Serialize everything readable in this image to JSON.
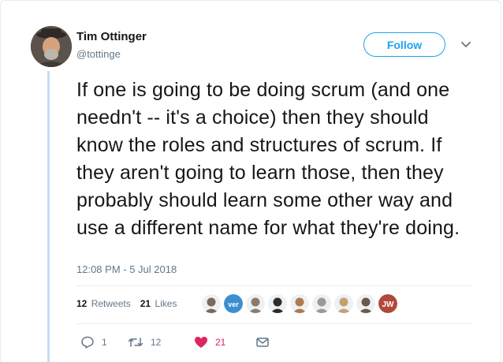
{
  "author": {
    "name": "Tim Ottinger",
    "handle": "@tottinge",
    "avatar_icon": "user-avatar"
  },
  "follow_button": {
    "label": "Follow",
    "color": "#1da1f2"
  },
  "menu_icon": "chevron-down-icon",
  "tweet": {
    "text": "If one is going to be doing scrum (and one needn't -- it's a choice) then they should know the roles and structures of scrum. If they aren't going to learn those, then they probably should learn some other way and use a different name for what they're doing.",
    "timestamp": "12:08 PM - 5 Jul 2018"
  },
  "stats": {
    "retweets_count": "12",
    "retweets_label": "Retweets",
    "likes_count": "21",
    "likes_label": "Likes"
  },
  "likers": [
    {
      "name": "liker-1",
      "color": "#7a6a5e"
    },
    {
      "name": "liker-2",
      "color": "#3b8fd0",
      "text": "ver"
    },
    {
      "name": "liker-3",
      "color": "#8a7c6a"
    },
    {
      "name": "liker-4",
      "color": "#2c2c2c"
    },
    {
      "name": "liker-5",
      "color": "#b07a4c"
    },
    {
      "name": "liker-6",
      "color": "#9a9a9a"
    },
    {
      "name": "liker-7",
      "color": "#c8a070"
    },
    {
      "name": "liker-8",
      "color": "#6b5a4a"
    },
    {
      "name": "liker-9",
      "color": "#b0493a",
      "text": "JW"
    }
  ],
  "actions": {
    "reply_count": "1",
    "retweet_count": "12",
    "like_count": "21",
    "like_color": "#e0245e"
  }
}
